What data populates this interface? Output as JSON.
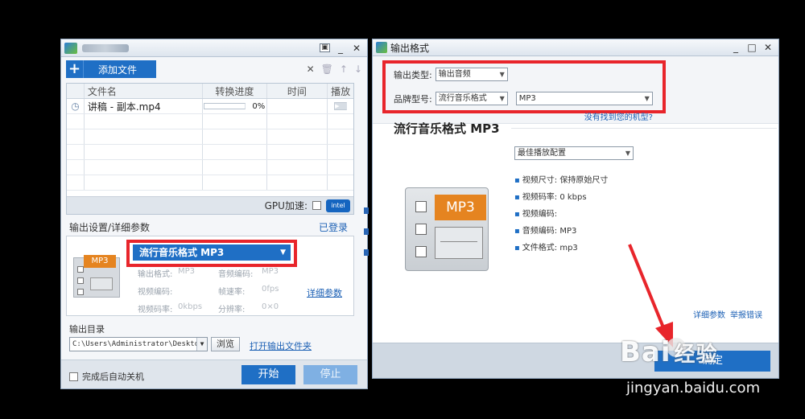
{
  "left_window": {
    "title": "",
    "toolbar": {
      "add_file": "添加文件",
      "icons": [
        "close-icon",
        "trash-icon",
        "arrow-up-icon",
        "arrow-down-icon"
      ]
    },
    "table": {
      "headers": [
        "文件名",
        "转换进度",
        "时间",
        "播放"
      ],
      "rows": [
        {
          "name": "讲稿 - 副本.mp4",
          "progress": "0%",
          "time": ""
        }
      ]
    },
    "gpu_label": "GPU加速:",
    "gpu_badge": "intel",
    "output_settings_label": "输出设置/详细参数",
    "logged_in": "已登录",
    "format_select": "流行音乐格式 MP3",
    "mini_badge": "MP3",
    "params": {
      "out_format_label": "输出格式:",
      "out_format_value": "MP3",
      "audio_codec_label": "音频编码:",
      "audio_codec_value": "MP3",
      "video_codec_label": "视频编码:",
      "video_codec_value": "",
      "fps_label": "帧速率:",
      "fps_value": "0fps",
      "video_bitrate_label": "视频码率:",
      "video_bitrate_value": "0kbps",
      "resolution_label": "分辨率:",
      "resolution_value": "0×0"
    },
    "detail_params": "详细参数",
    "output_dir_label": "输出目录",
    "output_path": "C:\\Users\\Administrator\\Desktop",
    "browse": "浏览",
    "open_folder": "打开输出文件夹",
    "auto_shutdown": "完成后自动关机",
    "start": "开始",
    "stop": "停止"
  },
  "right_window": {
    "title": "输出格式",
    "output_type_label": "输出类型:",
    "output_type_value": "输出音频",
    "brand_label": "品牌型号:",
    "brand_value": "流行音乐格式",
    "model_value": "MP3",
    "no_model_link": "没有找到您的机型?",
    "heading": "流行音乐格式 MP3",
    "preset_value": "最佳播放配置",
    "badge": "MP3",
    "info": [
      "视频尺寸: 保持原始尺寸",
      "视频码率: 0 kbps",
      "视频编码:",
      "音频编码: MP3",
      "文件格式: mp3"
    ],
    "detail_params": "详细参数",
    "report_error": "举报错误",
    "confirm": "确定"
  },
  "watermark": {
    "brand": "Bai",
    "brand_cn": "经验",
    "url": "jingyan.baidu.com"
  },
  "colors": {
    "accent": "#1f6fc5",
    "highlight": "#e8252b",
    "badge": "#e58420"
  }
}
